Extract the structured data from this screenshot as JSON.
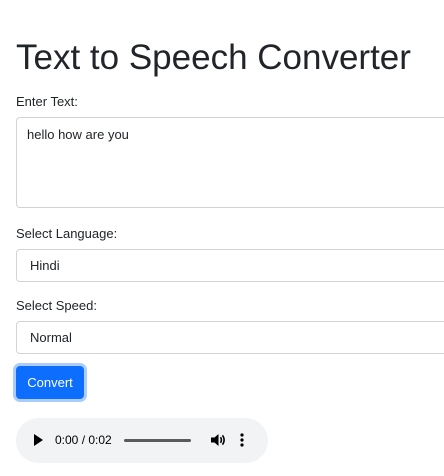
{
  "page": {
    "title": "Text to Speech Converter"
  },
  "form": {
    "text_label": "Enter Text:",
    "text_value": "hello how are you",
    "language_label": "Select Language:",
    "language_value": "Hindi",
    "speed_label": "Select Speed:",
    "speed_value": "Normal",
    "convert_label": "Convert"
  },
  "audio": {
    "time": "0:00 / 0:02",
    "progress": 0,
    "icons": [
      "play-icon",
      "volume-icon",
      "more-options-icon"
    ]
  },
  "colors": {
    "accent": "#0d6efd",
    "audio_bg": "#f1f3f4"
  }
}
